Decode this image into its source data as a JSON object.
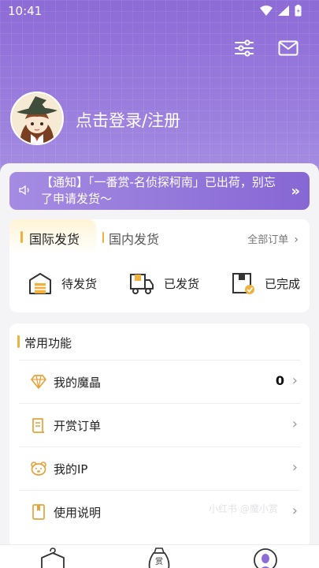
{
  "status_bar": {
    "time": "10:41"
  },
  "header": {
    "settings_icon": "sliders-icon",
    "message_icon": "envelope-icon"
  },
  "profile": {
    "login_text": "点击登录/注册"
  },
  "notice": {
    "text": "【通知】「一番赏-名侦探柯南」已出荷，别忘了申请发货～",
    "arrow": "»"
  },
  "orders": {
    "tabs": [
      {
        "label": "国际发货",
        "active": true
      },
      {
        "label": "国内发货",
        "active": false
      }
    ],
    "all_orders_label": "全部订单",
    "statuses": [
      {
        "label": "待发货",
        "icon": "warehouse-icon"
      },
      {
        "label": "已发货",
        "icon": "truck-icon"
      },
      {
        "label": "已完成",
        "icon": "box-check-icon"
      }
    ]
  },
  "common": {
    "title": "常用功能",
    "items": [
      {
        "label": "我的魔晶",
        "icon": "diamond-icon",
        "value": "0"
      },
      {
        "label": "开赏订单",
        "icon": "receipt-icon",
        "value": ""
      },
      {
        "label": "我的IP",
        "icon": "bear-icon",
        "value": ""
      },
      {
        "label": "使用说明",
        "icon": "book-icon",
        "value": ""
      }
    ],
    "watermark": "小红书 @魔小赏"
  },
  "tabbar": {
    "items": [
      {
        "icon": "mystery-box-icon"
      },
      {
        "icon": "prize-bag-icon"
      },
      {
        "icon": "profile-icon",
        "active": true
      }
    ]
  },
  "colors": {
    "accent": "#8d6bd6",
    "highlight": "#f0b23d"
  }
}
